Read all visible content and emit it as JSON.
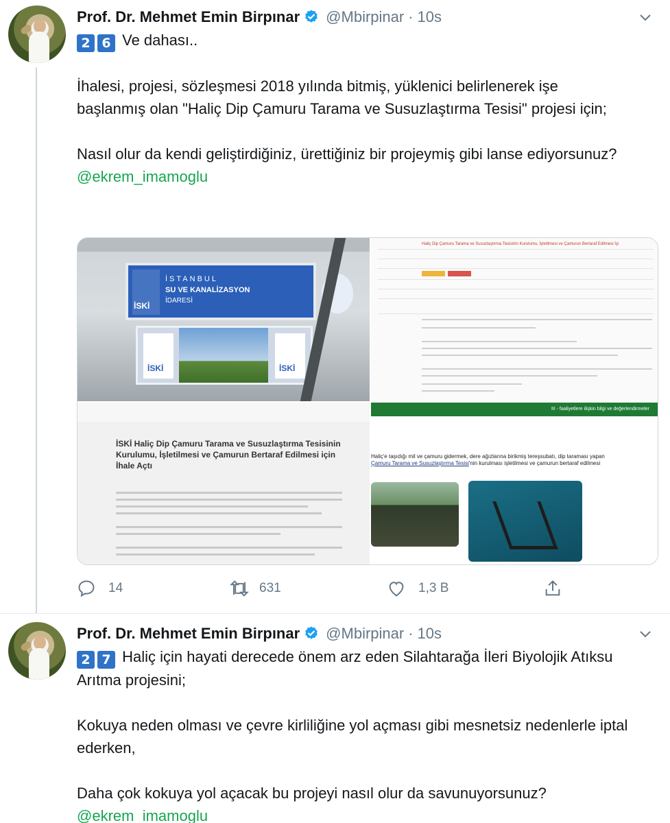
{
  "tweets": [
    {
      "name": "Prof. Dr. Mehmet Emin Birpınar",
      "handle": "@Mbirpinar",
      "separator": "·",
      "time": "10s",
      "emoji_digits": [
        "2",
        "6"
      ],
      "first_line": "Ve dahası..",
      "paragraphs": [
        "İhalesi, projesi, sözleşmesi 2018 yılında bitmiş, yüklenici belirlenerek işe başlanmış olan \"Haliç Dip Çamuru Tarama ve Susuzlaştırma Tesisi\" projesi için;",
        "Nasıl olur da kendi geliştirdiğiniz, ürettiğiniz bir projeymiş gibi lanse ediyorsunuz?"
      ],
      "mention": "@ekrem_imamoglu",
      "media": {
        "sign_line1": "İSTANBUL",
        "sign_line2": "SU VE KANALİZASYON",
        "sign_line3": "İDARESİ",
        "sign_logo": "İSKİ",
        "doc_title": "Haliç Dip Çamuru Tarama ve Susuzlaştırma Tesisinin Kurulumu, İşletilmesi ve Çamurun Bertaraf Edilmesi İşi",
        "article_title": "İSKİ Haliç Dip Çamuru Tarama ve Susuzlaştırma Tesisinin Kurulumu, İşletilmesi ve Çamurun Bertaraf Edilmesi için İhale Açtı",
        "panel_bar": "III - faaliyetlere ilişkin bilgi ve değerlendirmeler",
        "panel_text_1": "Haliç'e taşıdığı mil ve çamuru gidermek, dere ağızlarına birikmiş tereşsubatı, dip taraması yapan",
        "panel_link": "Çamuru Tarama ve Susuzlaştırma Tesisi",
        "panel_text_2": "'nin kurulması işletilmesi ve çamurun bertaraf edilmesi"
      },
      "actions": {
        "reply_count": "14",
        "retweet_count": "631",
        "like_count": "1,3 B"
      }
    },
    {
      "name": "Prof. Dr. Mehmet Emin Birpınar",
      "handle": "@Mbirpinar",
      "separator": "·",
      "time": "10s",
      "emoji_digits": [
        "2",
        "7"
      ],
      "first_line": "Haliç için hayati derecede önem arz eden Silahtarağa İleri Biyolojik Atıksu Arıtma projesini;",
      "paragraphs": [
        "Kokuya neden olması ve çevre kirliliğine yol açması gibi mesnetsiz nedenlerle iptal ederken,",
        "Daha çok kokuya yol açacak bu projeyi nasıl olur da savunuyorsunuz?"
      ],
      "mention": "@ekrem_imamoglu"
    }
  ],
  "colors": {
    "verified": "#1da1f2",
    "mention": "#17a550",
    "muted": "#657786",
    "emoji_keycap": "#2f73c9"
  },
  "icons": [
    "verified-badge-icon",
    "chevron-down-icon",
    "reply-icon",
    "retweet-icon",
    "like-icon",
    "share-icon"
  ]
}
